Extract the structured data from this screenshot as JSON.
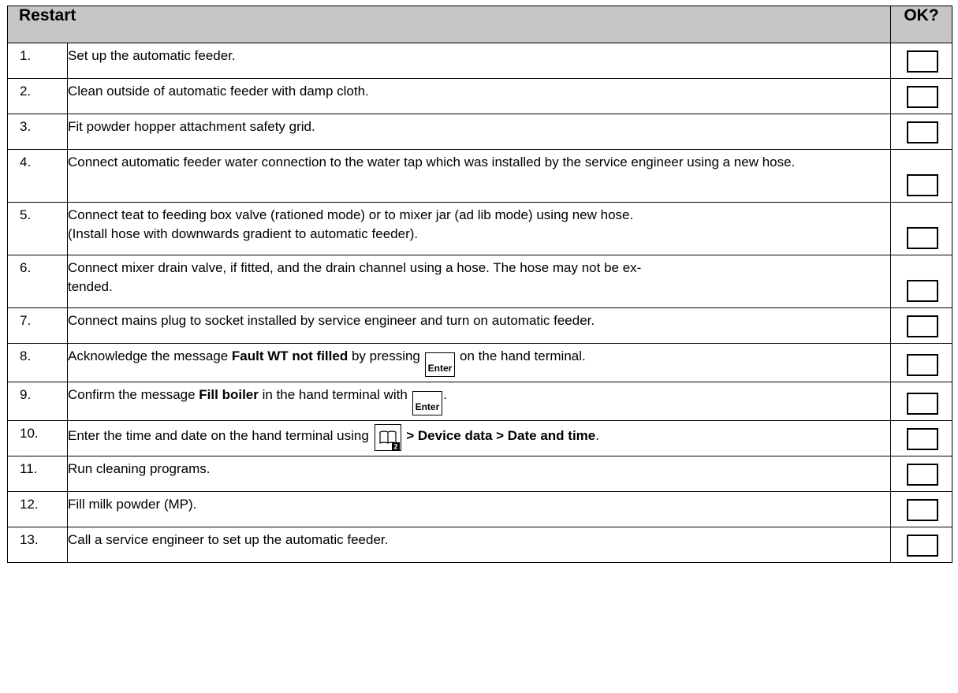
{
  "header": {
    "title": "Restart",
    "ok_label": "OK?"
  },
  "steps": [
    {
      "num": "1.",
      "text": "Set up the automatic feeder."
    },
    {
      "num": "2.",
      "text": "Clean outside of automatic feeder with damp cloth."
    },
    {
      "num": "3.",
      "text": "Fit powder hopper attachment safety grid."
    },
    {
      "num": "4.",
      "text": "Connect automatic feeder water connection to the water tap which was installed by the service engineer using a new hose."
    },
    {
      "num": "5.",
      "text_a": "Connect teat to feeding box valve (rationed mode) or to mixer jar (ad lib mode) using new hose.",
      "text_b": "(Install hose with downwards gradient to automatic feeder)."
    },
    {
      "num": "6.",
      "text": "Connect mixer drain valve, if fitted, and the drain channel using a hose. The hose may not be ex-tended."
    },
    {
      "num": "7.",
      "text": "Connect mains plug to socket installed by service engineer and turn on automatic feeder."
    },
    {
      "num": "8.",
      "pre": "Acknowledge the message ",
      "bold": "Fault WT not filled",
      "mid": " by pressing ",
      "key": "Enter",
      "post": " on the hand terminal."
    },
    {
      "num": "9.",
      "pre": "Confirm the message ",
      "bold": "Fill boiler",
      "mid": " in the hand terminal with ",
      "key": "Enter",
      "post": "."
    },
    {
      "num": "10.",
      "pre": "Enter the time and date on the hand terminal using ",
      "icon_badge": "2",
      "bold": " > Device data > Date and time",
      "post": "."
    },
    {
      "num": "11.",
      "text": "Run cleaning programs."
    },
    {
      "num": "12.",
      "text": "Fill milk powder (MP)."
    },
    {
      "num": "13.",
      "text": "Call a service engineer to set up the automatic feeder."
    }
  ]
}
